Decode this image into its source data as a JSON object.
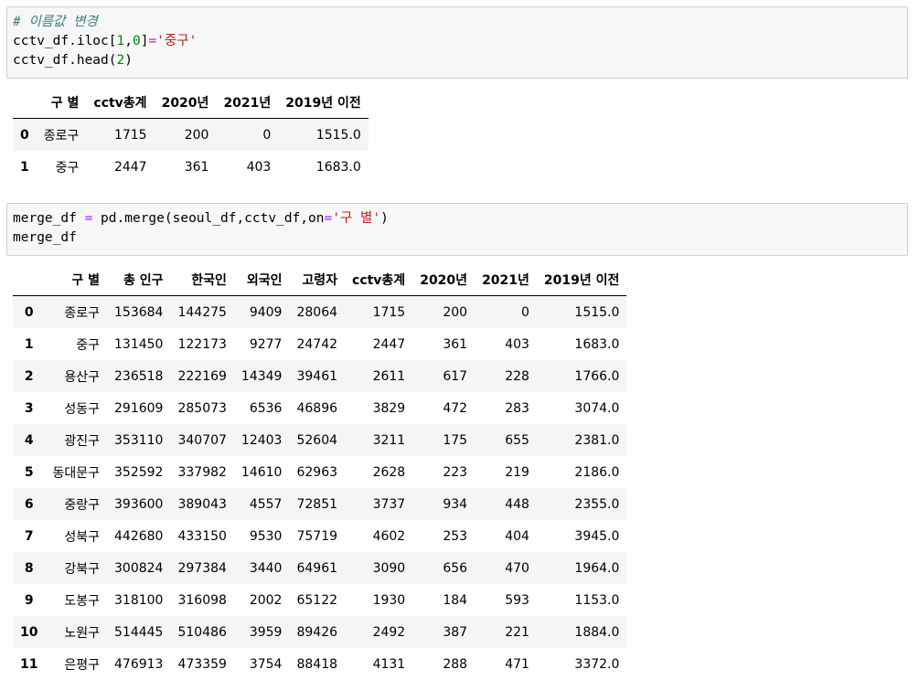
{
  "cell1": {
    "comment": "# 이름값 변경",
    "line2": {
      "a": "cctv_df.iloc[",
      "n1": "1",
      "c": ",",
      "n2": "0",
      "b": "]",
      "eq": "=",
      "s": "'중구'"
    },
    "line3": {
      "a": "cctv_df.head(",
      "n": "2",
      "b": ")"
    }
  },
  "out1": {
    "columns": [
      "",
      "구 별",
      "cctv총계",
      "2020년",
      "2021년",
      "2019년 이전"
    ],
    "rows": [
      [
        "0",
        "종로구",
        "1715",
        "200",
        "0",
        "1515.0"
      ],
      [
        "1",
        "중구",
        "2447",
        "361",
        "403",
        "1683.0"
      ]
    ]
  },
  "cell2": {
    "line1": {
      "a": "merge_df ",
      "eq": "=",
      "b": " pd.merge(seoul_df,cctv_df,on",
      "eq2": "=",
      "s": "'구 별'",
      "c": ")"
    },
    "line2": "merge_df"
  },
  "out2": {
    "columns": [
      "",
      "구 별",
      "총 인구",
      "한국인",
      "외국인",
      "고령자",
      "cctv총계",
      "2020년",
      "2021년",
      "2019년 이전"
    ],
    "rows": [
      [
        "0",
        "종로구",
        "153684",
        "144275",
        "9409",
        "28064",
        "1715",
        "200",
        "0",
        "1515.0"
      ],
      [
        "1",
        "중구",
        "131450",
        "122173",
        "9277",
        "24742",
        "2447",
        "361",
        "403",
        "1683.0"
      ],
      [
        "2",
        "용산구",
        "236518",
        "222169",
        "14349",
        "39461",
        "2611",
        "617",
        "228",
        "1766.0"
      ],
      [
        "3",
        "성동구",
        "291609",
        "285073",
        "6536",
        "46896",
        "3829",
        "472",
        "283",
        "3074.0"
      ],
      [
        "4",
        "광진구",
        "353110",
        "340707",
        "12403",
        "52604",
        "3211",
        "175",
        "655",
        "2381.0"
      ],
      [
        "5",
        "동대문구",
        "352592",
        "337982",
        "14610",
        "62963",
        "2628",
        "223",
        "219",
        "2186.0"
      ],
      [
        "6",
        "중랑구",
        "393600",
        "389043",
        "4557",
        "72851",
        "3737",
        "934",
        "448",
        "2355.0"
      ],
      [
        "7",
        "성북구",
        "442680",
        "433150",
        "9530",
        "75719",
        "4602",
        "253",
        "404",
        "3945.0"
      ],
      [
        "8",
        "강북구",
        "300824",
        "297384",
        "3440",
        "64961",
        "3090",
        "656",
        "470",
        "1964.0"
      ],
      [
        "9",
        "도봉구",
        "318100",
        "316098",
        "2002",
        "65122",
        "1930",
        "184",
        "593",
        "1153.0"
      ],
      [
        "10",
        "노원구",
        "514445",
        "510486",
        "3959",
        "89426",
        "2492",
        "387",
        "221",
        "1884.0"
      ],
      [
        "11",
        "은평구",
        "476913",
        "473359",
        "3754",
        "88418",
        "4131",
        "288",
        "471",
        "3372.0"
      ]
    ]
  }
}
